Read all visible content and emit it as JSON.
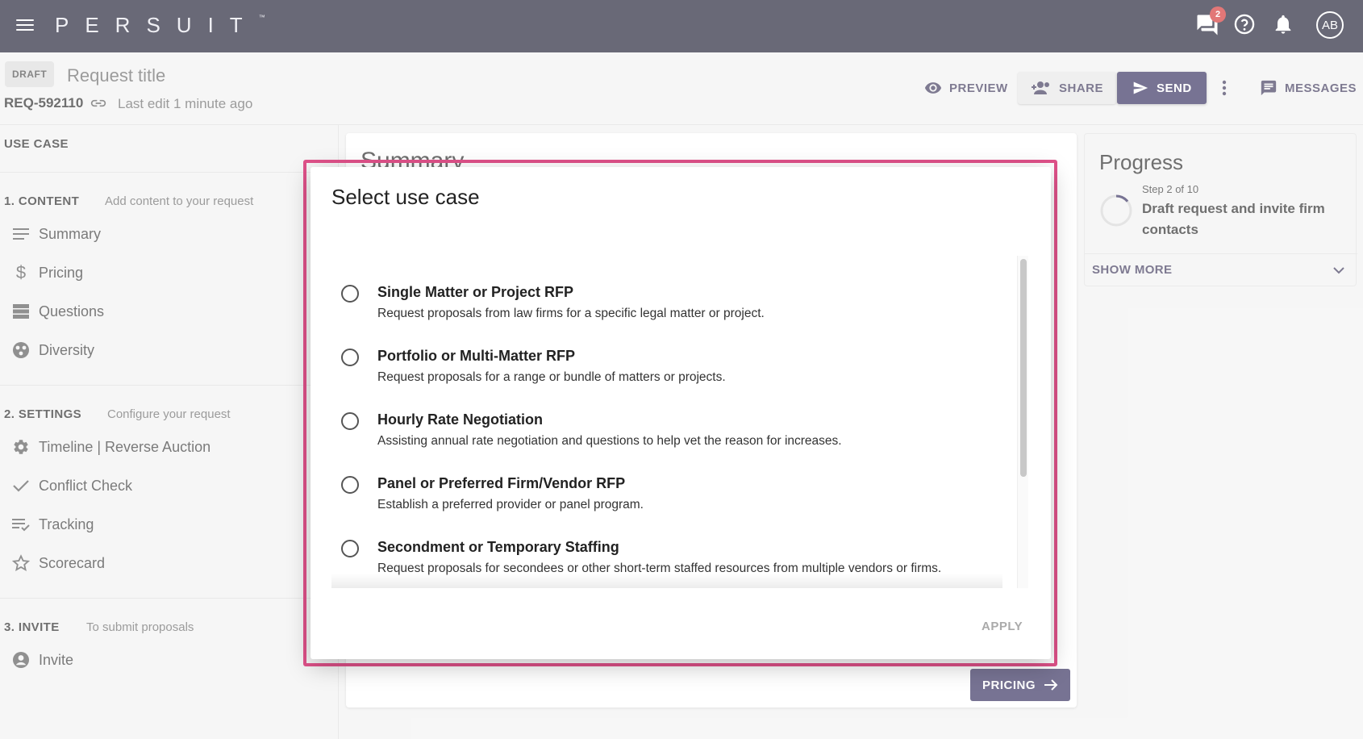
{
  "topbar": {
    "logo": "PERSUIT",
    "tm": "™",
    "messages_badge": "2",
    "avatar_initials": "AB"
  },
  "header": {
    "draft_label": "DRAFT",
    "title": "Request title",
    "request_id": "REQ-592110",
    "last_edit": "Last edit 1 minute ago",
    "preview_label": "PREVIEW",
    "share_label": "SHARE",
    "send_label": "SEND",
    "messages_label": "MESSAGES"
  },
  "sidebar": {
    "use_case_label": "USE CASE",
    "content_heading": "1. CONTENT",
    "content_sub": "Add content to your request",
    "content_items": [
      {
        "label": "Summary"
      },
      {
        "label": "Pricing"
      },
      {
        "label": "Questions"
      },
      {
        "label": "Diversity"
      }
    ],
    "settings_heading": "2. SETTINGS",
    "settings_sub": "Configure your request",
    "settings_items": [
      {
        "label": "Timeline | Reverse Auction"
      },
      {
        "label": "Conflict Check"
      },
      {
        "label": "Tracking"
      },
      {
        "label": "Scorecard"
      }
    ],
    "invite_heading": "3. INVITE",
    "invite_sub": "To submit proposals",
    "invite_items": [
      {
        "label": "Invite"
      }
    ]
  },
  "main": {
    "title": "Summary",
    "next_button_label": "PRICING"
  },
  "progress": {
    "title": "Progress",
    "step": "Step 2 of 10",
    "step_description": "Draft request and invite firm contacts",
    "show_more_label": "SHOW MORE"
  },
  "modal": {
    "title": "Select use case",
    "apply_label": "APPLY",
    "options": [
      {
        "title": "Single Matter or Project RFP",
        "description": "Request proposals from law firms for a specific legal matter or project."
      },
      {
        "title": "Portfolio or Multi-Matter RFP",
        "description": "Request proposals for a range or bundle of matters or projects."
      },
      {
        "title": "Hourly Rate Negotiation",
        "description": "Assisting annual rate negotiation and questions to help vet the reason for increases."
      },
      {
        "title": "Panel or Preferred Firm/Vendor RFP",
        "description": "Establish a preferred provider or panel program."
      },
      {
        "title": "Secondment or Temporary Staffing",
        "description": "Request proposals for secondees or other short-term staffed resources from multiple vendors or firms."
      }
    ]
  },
  "colors": {
    "topbar_bg": "#1a1a2e",
    "primary": "#2e2859",
    "highlight": "#e0528a",
    "badge": "#d32f2f"
  }
}
